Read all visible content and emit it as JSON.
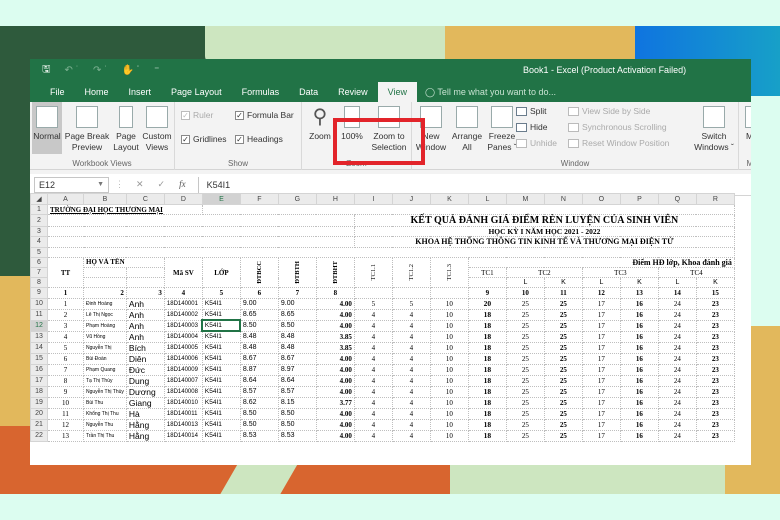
{
  "window": {
    "title": "Book1 - Excel (Product Activation Failed)"
  },
  "quick_access": [
    "save-icon",
    "undo-icon",
    "redo-icon",
    "touch-mode-icon",
    "customize-icon"
  ],
  "tabs": [
    {
      "label": "File"
    },
    {
      "label": "Home"
    },
    {
      "label": "Insert"
    },
    {
      "label": "Page Layout"
    },
    {
      "label": "Formulas"
    },
    {
      "label": "Data"
    },
    {
      "label": "Review"
    },
    {
      "label": "View",
      "active": true
    }
  ],
  "tell_me": "Tell me what you want to do...",
  "ribbon": {
    "workbook_views": {
      "label": "Workbook Views",
      "normal": "Normal",
      "page_break_1": "Page Break",
      "page_break_2": "Preview",
      "page_layout_1": "Page",
      "page_layout_2": "Layout",
      "custom_views_1": "Custom",
      "custom_views_2": "Views"
    },
    "show": {
      "label": "Show",
      "ruler": "Ruler",
      "formula_bar": "Formula Bar",
      "gridlines": "Gridlines",
      "headings": "Headings",
      "ruler_checked": true,
      "formula_bar_checked": true,
      "gridlines_checked": true,
      "headings_checked": true
    },
    "zoom": {
      "label": "Zoom",
      "zoom": "Zoom",
      "hundred": "100%",
      "zoom_sel_1": "Zoom to",
      "zoom_sel_2": "Selection"
    },
    "window": {
      "label": "Window",
      "new_1": "New",
      "new_2": "Window",
      "arrange_1": "Arrange",
      "arrange_2": "All",
      "freeze_1": "Freeze",
      "freeze_2": "Panes ˇ",
      "split": "Split",
      "hide": "Hide",
      "unhide": "Unhide",
      "side_by_side": "View Side by Side",
      "sync_scroll": "Synchronous Scrolling",
      "reset_pos": "Reset Window Position",
      "switch_1": "Switch",
      "switch_2": "Windows ˇ"
    },
    "macros": {
      "label": "Mac",
      "button": "Mac"
    }
  },
  "formula_bar": {
    "name_box": "E12",
    "fx": "fx",
    "value": "K54I1"
  },
  "columns": [
    "A",
    "B",
    "C",
    "D",
    "E",
    "F",
    "G",
    "H",
    "I",
    "J",
    "K",
    "L",
    "M",
    "N",
    "O",
    "P",
    "Q",
    "R"
  ],
  "selected_column": "E",
  "selected_row": "12",
  "sheet": {
    "school": "TRƯỜNG ĐẠI HỌC THƯƠNG MẠI",
    "title": "KẾT QUẢ ĐÁNH GIÁ ĐIỂM RÈN LUYỆN CỦA SINH VIÊN",
    "subtitle": "HỌC KỲ I NĂM HỌC 2021 - 2022",
    "faculty": "KHOA HỆ THỐNG THÔNG TIN KINH TẾ VÀ THƯƠNG MẠI ĐIỆN TỬ",
    "hdr": {
      "tt": "TT",
      "ho_ten": "HỌ VÀ TÊN",
      "ma_sv": "Mã SV",
      "lop": "LỚP",
      "dtbcc": "ĐTBCC",
      "dtbth": "ĐTBTH",
      "dtbht": "ĐTBHT",
      "tc11": "TC1.1",
      "tc12": "TC1.2",
      "tc13": "TC1.3",
      "diem_hd": "Điểm HĐ lớp, Khoa đánh giá",
      "tc1": "TC1",
      "tc2": "TC2",
      "tc3": "TC3",
      "tc4": "TC4",
      "l": "L",
      "k": "K"
    },
    "index_row": [
      "1",
      "2",
      "3",
      "4",
      "5",
      "6",
      "7",
      "8",
      "",
      "",
      "",
      "9",
      "10",
      "11",
      "12",
      "13",
      "14",
      "15"
    ],
    "rows": [
      {
        "r": "10",
        "tt": "1",
        "ho": "Đinh Hoàng",
        "ten": "Anh",
        "ma": "18D140001",
        "lop": "K54I1",
        "cc": "9.00",
        "th": "9.00",
        "ht": "4.00",
        "t11": "5",
        "t12": "5",
        "t13": "10",
        "tc1": "20",
        "tc2l": "25",
        "tc2k": "25",
        "tc3l": "17",
        "tc3k": "16",
        "tc4l": "24",
        "tc4k": "23"
      },
      {
        "r": "11",
        "tt": "2",
        "ho": "Lê Thị Ngọc",
        "ten": "Anh",
        "ma": "18D140002",
        "lop": "K54I1",
        "cc": "8.65",
        "th": "8.65",
        "ht": "4.00",
        "t11": "4",
        "t12": "4",
        "t13": "10",
        "tc1": "18",
        "tc2l": "25",
        "tc2k": "25",
        "tc3l": "17",
        "tc3k": "16",
        "tc4l": "24",
        "tc4k": "23"
      },
      {
        "r": "12",
        "tt": "3",
        "ho": "Phạm Hoàng",
        "ten": "Anh",
        "ma": "18D140003",
        "lop": "K54I1",
        "cc": "8.50",
        "th": "8.50",
        "ht": "4.00",
        "t11": "4",
        "t12": "4",
        "t13": "10",
        "tc1": "18",
        "tc2l": "25",
        "tc2k": "25",
        "tc3l": "17",
        "tc3k": "16",
        "tc4l": "24",
        "tc4k": "23"
      },
      {
        "r": "13",
        "tt": "4",
        "ho": "Vũ Hồng",
        "ten": "Anh",
        "ma": "18D140004",
        "lop": "K54I1",
        "cc": "8.48",
        "th": "8.48",
        "ht": "3.85",
        "t11": "4",
        "t12": "4",
        "t13": "10",
        "tc1": "18",
        "tc2l": "25",
        "tc2k": "25",
        "tc3l": "17",
        "tc3k": "16",
        "tc4l": "24",
        "tc4k": "23"
      },
      {
        "r": "14",
        "tt": "5",
        "ho": "Nguyễn Thị",
        "ten": "Bích",
        "ma": "18D140005",
        "lop": "K54I1",
        "cc": "8.48",
        "th": "8.48",
        "ht": "3.85",
        "t11": "4",
        "t12": "4",
        "t13": "10",
        "tc1": "18",
        "tc2l": "25",
        "tc2k": "25",
        "tc3l": "17",
        "tc3k": "16",
        "tc4l": "24",
        "tc4k": "23"
      },
      {
        "r": "15",
        "tt": "6",
        "ho": "Bùi Đoàn",
        "ten": "Diên",
        "ma": "18D140006",
        "lop": "K54I1",
        "cc": "8.67",
        "th": "8.67",
        "ht": "4.00",
        "t11": "4",
        "t12": "4",
        "t13": "10",
        "tc1": "18",
        "tc2l": "25",
        "tc2k": "25",
        "tc3l": "17",
        "tc3k": "16",
        "tc4l": "24",
        "tc4k": "23"
      },
      {
        "r": "16",
        "tt": "7",
        "ho": "Phạm Quang",
        "ten": "Đức",
        "ma": "18D140009",
        "lop": "K54I1",
        "cc": "8.87",
        "th": "8.97",
        "ht": "4.00",
        "t11": "4",
        "t12": "4",
        "t13": "10",
        "tc1": "18",
        "tc2l": "25",
        "tc2k": "25",
        "tc3l": "17",
        "tc3k": "16",
        "tc4l": "24",
        "tc4k": "23"
      },
      {
        "r": "17",
        "tt": "8",
        "ho": "Tạ Thị Thùy",
        "ten": "Dung",
        "ma": "18D140007",
        "lop": "K54I1",
        "cc": "8.64",
        "th": "8.64",
        "ht": "4.00",
        "t11": "4",
        "t12": "4",
        "t13": "10",
        "tc1": "18",
        "tc2l": "25",
        "tc2k": "25",
        "tc3l": "17",
        "tc3k": "16",
        "tc4l": "24",
        "tc4k": "23"
      },
      {
        "r": "18",
        "tt": "9",
        "ho": "Nguyễn Thị Thùy",
        "ten": "Dương",
        "ma": "18D140008",
        "lop": "K54I1",
        "cc": "8.57",
        "th": "8.57",
        "ht": "4.00",
        "t11": "4",
        "t12": "4",
        "t13": "10",
        "tc1": "18",
        "tc2l": "25",
        "tc2k": "25",
        "tc3l": "17",
        "tc3k": "16",
        "tc4l": "24",
        "tc4k": "23"
      },
      {
        "r": "19",
        "tt": "10",
        "ho": "Bùi Thu",
        "ten": "Giang",
        "ma": "18D140010",
        "lop": "K54I1",
        "cc": "8.62",
        "th": "8.15",
        "ht": "3.77",
        "t11": "4",
        "t12": "4",
        "t13": "10",
        "tc1": "18",
        "tc2l": "25",
        "tc2k": "25",
        "tc3l": "17",
        "tc3k": "16",
        "tc4l": "24",
        "tc4k": "23"
      },
      {
        "r": "20",
        "tt": "11",
        "ho": "Khổng Thị Thu",
        "ten": "Hà",
        "ma": "18D140011",
        "lop": "K54I1",
        "cc": "8.50",
        "th": "8.50",
        "ht": "4.00",
        "t11": "4",
        "t12": "4",
        "t13": "10",
        "tc1": "18",
        "tc2l": "25",
        "tc2k": "25",
        "tc3l": "17",
        "tc3k": "16",
        "tc4l": "24",
        "tc4k": "23"
      },
      {
        "r": "21",
        "tt": "12",
        "ho": "Nguyễn Thu",
        "ten": "Hằng",
        "ma": "18D140013",
        "lop": "K54I1",
        "cc": "8.50",
        "th": "8.50",
        "ht": "4.00",
        "t11": "4",
        "t12": "4",
        "t13": "10",
        "tc1": "18",
        "tc2l": "25",
        "tc2k": "25",
        "tc3l": "17",
        "tc3k": "16",
        "tc4l": "24",
        "tc4k": "23"
      },
      {
        "r": "22",
        "tt": "13",
        "ho": "Trần Thị Thu",
        "ten": "Hằng",
        "ma": "18D140014",
        "lop": "K54I1",
        "cc": "8.53",
        "th": "8.53",
        "ht": "4.00",
        "t11": "4",
        "t12": "4",
        "t13": "10",
        "tc1": "18",
        "tc2l": "25",
        "tc2k": "25",
        "tc3l": "17",
        "tc3k": "16",
        "tc4l": "24",
        "tc4k": "23"
      }
    ]
  }
}
